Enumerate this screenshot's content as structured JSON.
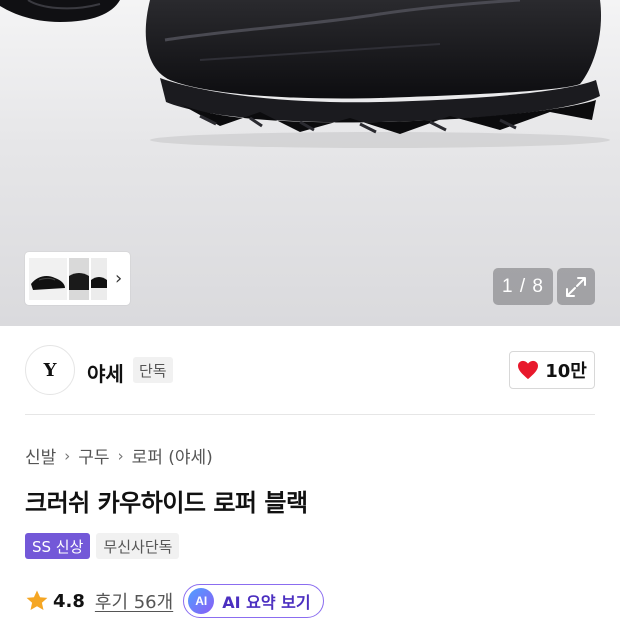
{
  "gallery": {
    "counter": "1 / 8",
    "thumb_next_icon": "chevron-right-icon",
    "expand_icon": "expand-icon"
  },
  "brand": {
    "logo_text": "Y",
    "name": "야세",
    "badge": "단독"
  },
  "like": {
    "icon": "heart-icon",
    "count": "10만",
    "color": "#e8192c"
  },
  "breadcrumb": [
    "신발",
    "구두",
    "로퍼 (야세)"
  ],
  "product": {
    "title": "크러쉬 카우하이드 로퍼 블랙",
    "tags": [
      "SS 신상",
      "무신사단독"
    ]
  },
  "rating": {
    "icon": "star-icon",
    "value": "4.8",
    "reviews": "후기 56개",
    "star_color": "#f5a623"
  },
  "ai_summary": {
    "badge": "AI",
    "label": "AI 요약 보기",
    "accent": "#7358d8"
  }
}
